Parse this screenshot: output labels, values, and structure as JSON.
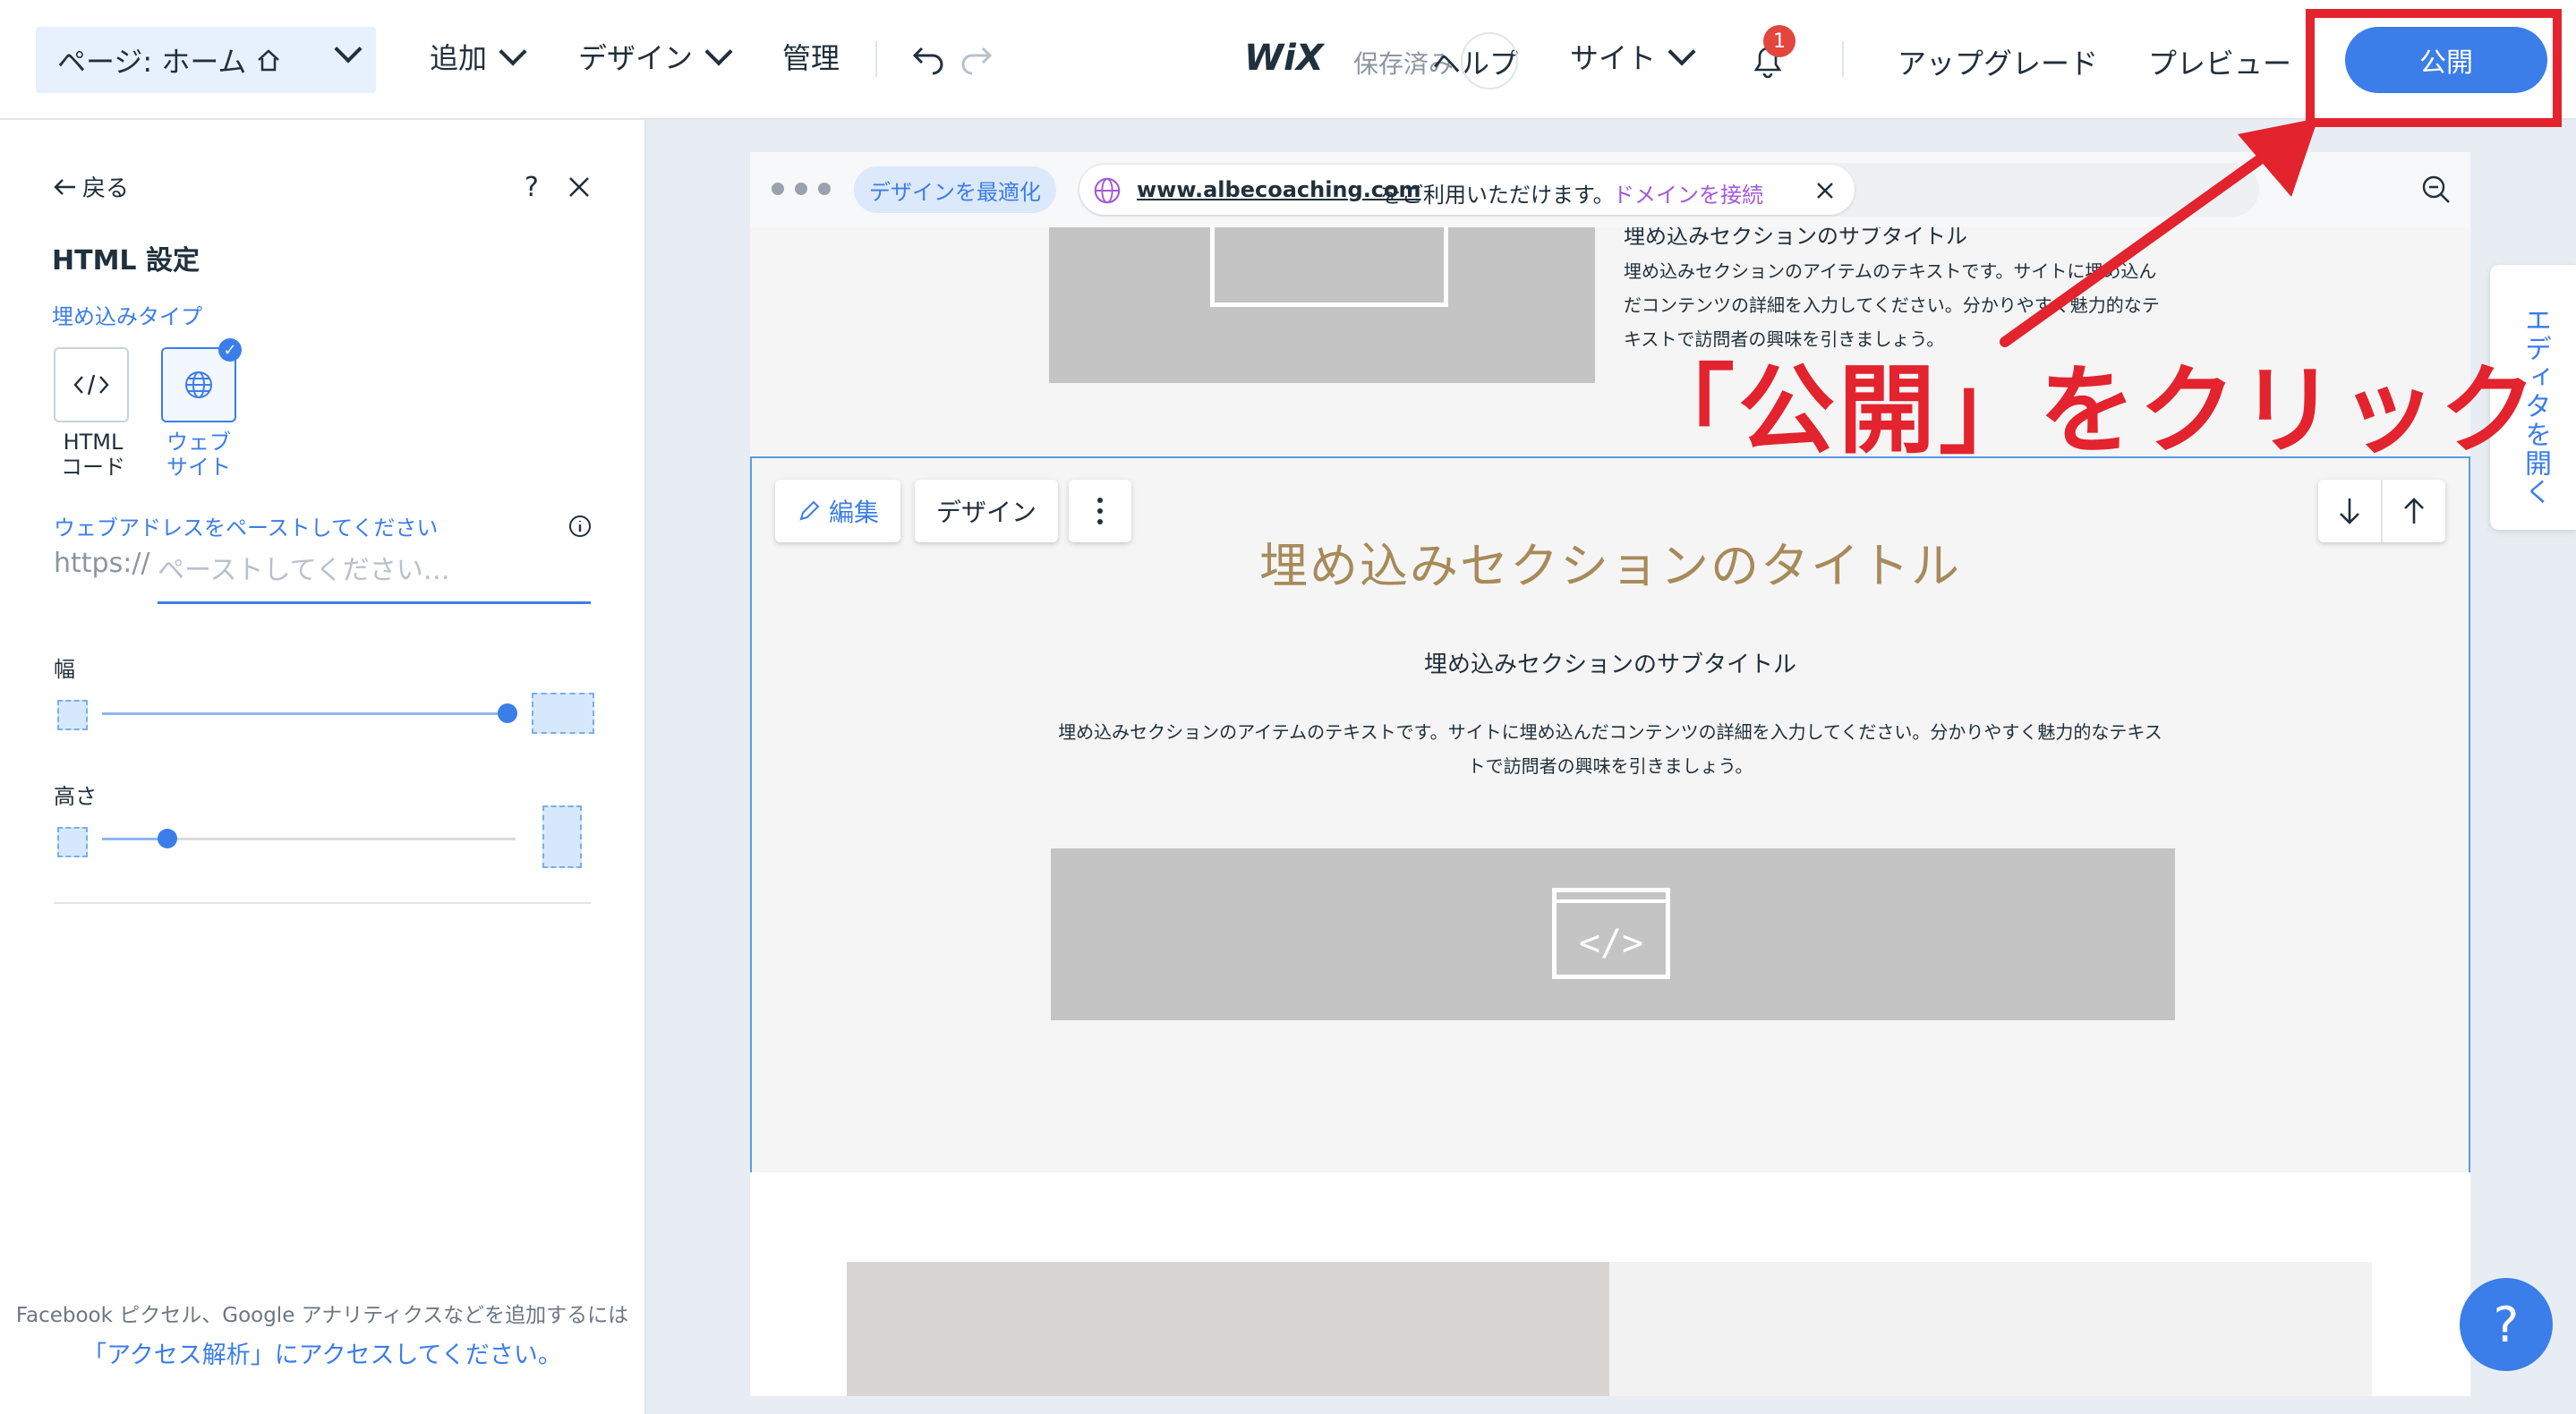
{
  "topbar": {
    "page_label": "ページ: ホーム",
    "menu_add": "追加",
    "menu_design": "デザイン",
    "menu_manage": "管理",
    "logo": "WiX",
    "saved_status": "保存済み",
    "help": "ヘルプ",
    "menu_site": "サイト",
    "notification_count": "1",
    "upgrade": "アップグレード",
    "preview": "プレビュー",
    "publish": "公開"
  },
  "left_panel": {
    "back": "戻る",
    "help_q": "?",
    "title": "HTML 設定",
    "embed_type_label": "埋め込みタイプ",
    "option_html": "HTML コード",
    "option_website": "ウェブ サイト",
    "url_label": "ウェブアドレスをペーストしてください",
    "url_prefix": "https://",
    "url_placeholder": "ペーストしてください…",
    "width_label": "幅",
    "height_label": "高さ",
    "width_value": 1.0,
    "height_value": 0.16,
    "footer_line1": "Facebook ピクセル、Google アナリティクスなどを追加するには",
    "footer_line2": "「アクセス解析」にアクセスしてください。"
  },
  "browser": {
    "optimize_button": "デザインを最適化",
    "domain": "www.albecoaching.com",
    "domain_suffix": " をご利用いただけます。",
    "connect_domain": "ドメインを接続"
  },
  "site": {
    "top_subtitle": "埋め込みセクションのサブタイトル",
    "top_text": "埋め込みセクションのアイテムのテキストです。サイトに埋め込んだコンテンツの詳細を入力してください。分かりやすく魅力的なテキストで訪問者の興味を引きましょう。",
    "edit_button": "編集",
    "design_button": "デザイン",
    "section_title": "埋め込みセクションのタイトル",
    "section_subtitle": "埋め込みセクションのサブタイトル",
    "section_text_1": "埋め込みセクションのアイテムのテキストです。サイトに埋め込んだコンテンツの詳細を入力してください。分かりやすく魅力的なテキス",
    "section_text_2": "トで訪問者の興味を引きましょう。",
    "embed_icon": "</>"
  },
  "side_tab": {
    "label": "エディタを開く"
  },
  "help_fab": {
    "label": "?"
  },
  "annotation": {
    "text": "「公開」をクリック",
    "color": "#e3232d"
  },
  "colors": {
    "accent": "#3b7de9",
    "title_gold": "#a88a5a",
    "annotation_red": "#e3232d"
  }
}
